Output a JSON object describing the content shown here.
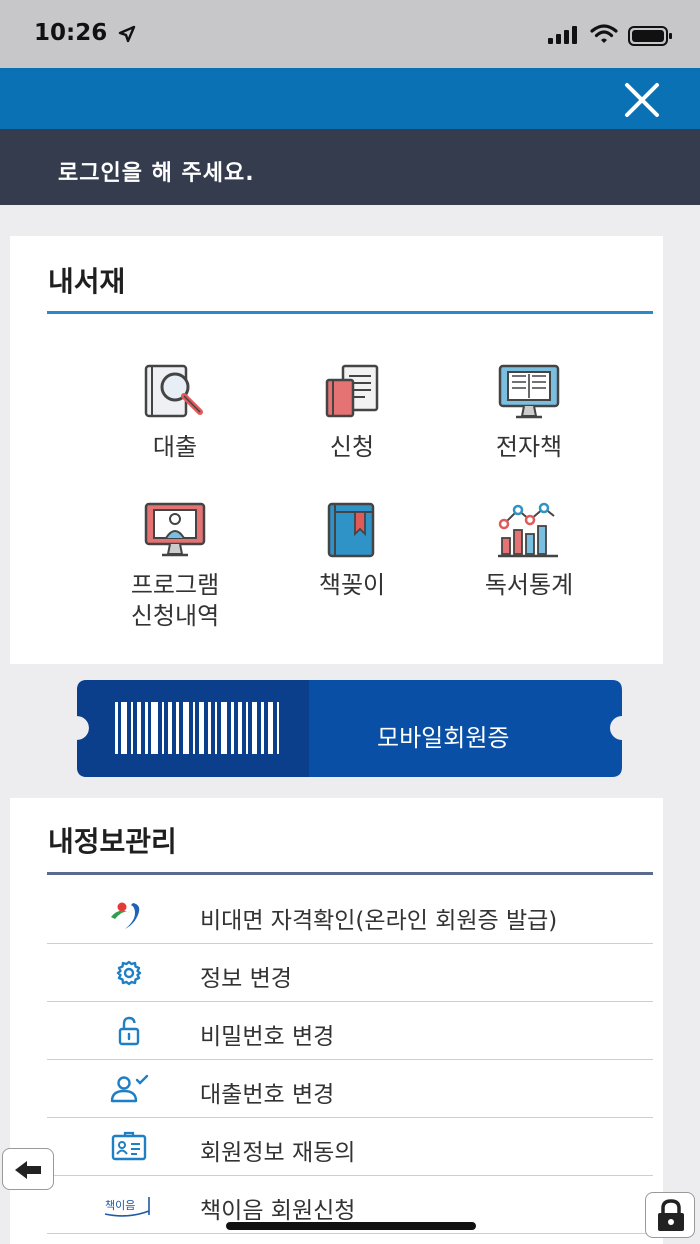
{
  "status_bar": {
    "time": "10:26"
  },
  "header": {
    "login_prompt": "로그인을 해 주세요."
  },
  "my_library": {
    "title": "내서재",
    "items": [
      {
        "label": "대출",
        "icon": "book-search-icon"
      },
      {
        "label": "신청",
        "icon": "book-request-icon"
      },
      {
        "label": "전자책",
        "icon": "ebook-monitor-icon"
      },
      {
        "label": "프로그램\n신청내역",
        "icon": "program-monitor-icon"
      },
      {
        "label": "책꽂이",
        "icon": "bookshelf-bookmark-icon"
      },
      {
        "label": "독서통계",
        "icon": "reading-stats-icon"
      }
    ]
  },
  "member_card": {
    "label": "모바일회원증"
  },
  "my_info": {
    "title": "내정보관리",
    "items": [
      {
        "label": "비대면 자격확인(온라인 회원증 발급)",
        "icon": "seoul-logo-icon"
      },
      {
        "label": "정보 변경",
        "icon": "gear-icon"
      },
      {
        "label": "비밀번호 변경",
        "icon": "unlock-icon"
      },
      {
        "label": "대출번호 변경",
        "icon": "user-check-icon"
      },
      {
        "label": "회원정보 재동의",
        "icon": "id-card-icon"
      },
      {
        "label": "책이음 회원신청",
        "icon": "chaekieum-logo-icon"
      }
    ],
    "chaekieum_logo_text": "책이음"
  },
  "colors": {
    "header_blue": "#0a71b5",
    "login_bar": "#353c4e",
    "card_blue": "#0a4fa6",
    "accent": "#2b88c9"
  }
}
